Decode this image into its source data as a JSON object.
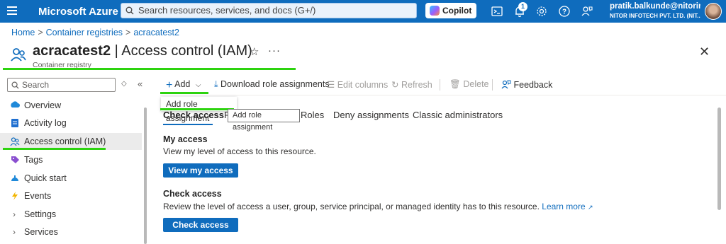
{
  "topbar": {
    "brand": "Microsoft Azure",
    "search_placeholder": "Search resources, services, and docs (G+/)",
    "copilot_label": "Copilot",
    "notification_count": "1",
    "user_email": "pratik.balkunde@nitorin...",
    "user_org": "NITOR INFOTECH PVT. LTD. (NIT...",
    "icons": [
      "hamburger-icon",
      "search-icon",
      "copilot-icon",
      "cloud-shell-icon",
      "notifications-icon",
      "settings-icon",
      "help-icon",
      "feedback-icon",
      "avatar"
    ]
  },
  "breadcrumb": {
    "items": [
      "Home",
      "Container registries",
      "acracatest2"
    ],
    "separator": ">"
  },
  "header": {
    "resource_name": "acracatest2",
    "page_name": "| Access control (IAM)",
    "subtitle": "Container registry",
    "star": "☆",
    "more": "···",
    "close": "✕"
  },
  "sidebar": {
    "search_placeholder": "Search",
    "sort_glyph": "◇",
    "collapse_glyph": "«",
    "items": [
      {
        "label": "Overview",
        "icon": "overview-icon"
      },
      {
        "label": "Activity log",
        "icon": "activity-log-icon"
      },
      {
        "label": "Access control (IAM)",
        "icon": "iam-icon"
      },
      {
        "label": "Tags",
        "icon": "tag-icon"
      },
      {
        "label": "Quick start",
        "icon": "quick-start-icon"
      },
      {
        "label": "Events",
        "icon": "events-icon"
      },
      {
        "label": "Settings",
        "icon": "chevron-right-icon"
      },
      {
        "label": "Services",
        "icon": "chevron-right-icon"
      }
    ]
  },
  "toolbar": {
    "add": "Add",
    "download": "Download role assignments",
    "edit_columns": "Edit columns",
    "refresh": "Refresh",
    "delete": "Delete",
    "feedback": "Feedback"
  },
  "dropdown": {
    "item": "Add role assignment"
  },
  "tooltip": {
    "text": "Add role assignment"
  },
  "tabs": {
    "check_access": "Check access",
    "role_assignments_partial": "R",
    "roles": "Roles",
    "deny_assignments": "Deny assignments",
    "classic_administrators": "Classic administrators"
  },
  "content": {
    "my_access_heading": "My access",
    "my_access_text": "View my level of access to this resource.",
    "view_my_access_button": "View my access",
    "check_access_heading": "Check access",
    "check_access_text": "Review the level of access a user, group, service principal, or managed identity has to this resource.",
    "learn_more": "Learn more",
    "check_access_button": "Check access"
  }
}
